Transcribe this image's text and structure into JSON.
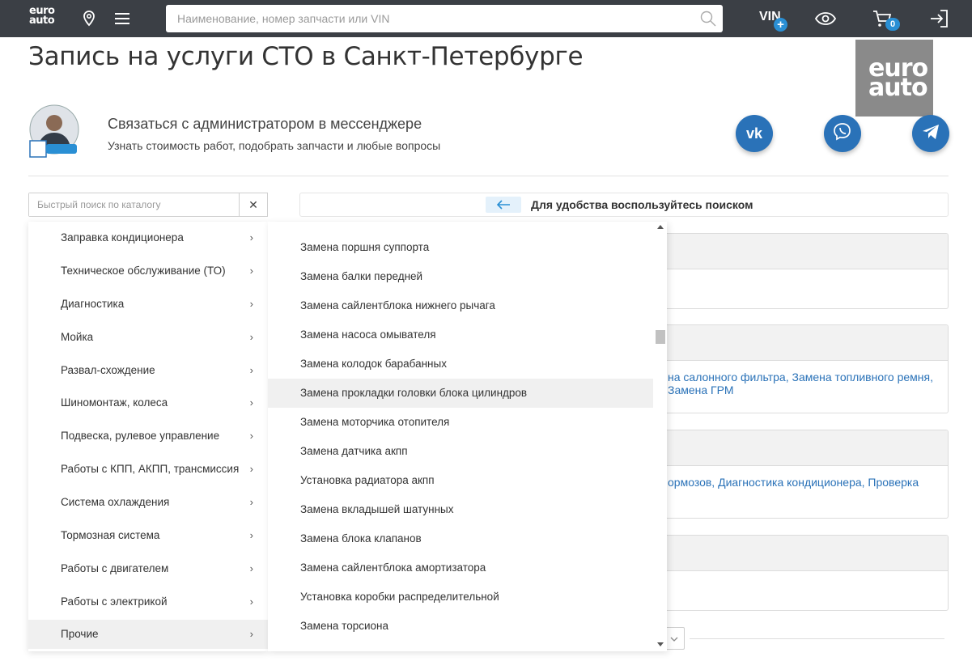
{
  "header": {
    "logo_line1": "euro",
    "logo_line2": "auto",
    "search_placeholder": "Наименование, номер запчасти или VIN",
    "vin_label": "VIN",
    "vin_plus": "+",
    "cart_count": "0"
  },
  "page": {
    "title": "Запись на услуги СТО в Санкт-Петербурге",
    "logo_line1": "euro",
    "logo_line2": "auto"
  },
  "messenger": {
    "title": "Связаться с администратором в мессенджере",
    "subtitle": "Узнать стоимость работ, подобрать запчасти и любые вопросы",
    "vk_label": "vk"
  },
  "quick_search": {
    "placeholder": "Быстрый поиск по каталогу",
    "clear": "✕"
  },
  "hint": {
    "text": "Для удобства воспользуйтесь поиском"
  },
  "cards": [
    {
      "text": ""
    },
    {
      "text": "на салонного фильтра, Замена топливного ремня, Замена ГРМ"
    },
    {
      "text": "ормозов, Диагностика кондиционера, Проверка"
    },
    {
      "text": ""
    }
  ],
  "categories": [
    {
      "label": "Заправка кондиционера"
    },
    {
      "label": "Техническое обслуживание (ТО)"
    },
    {
      "label": "Диагностика"
    },
    {
      "label": "Мойка"
    },
    {
      "label": "Развал-схождение"
    },
    {
      "label": "Шиномонтаж, колеса"
    },
    {
      "label": "Подвеска, рулевое управление"
    },
    {
      "label": "Работы с КПП, АКПП, трансмиссия"
    },
    {
      "label": "Система охлаждения"
    },
    {
      "label": "Тормозная система"
    },
    {
      "label": "Работы с двигателем"
    },
    {
      "label": "Работы с электрикой"
    },
    {
      "label": "Прочие"
    }
  ],
  "subitems": [
    {
      "label": "Замена поршня суппорта"
    },
    {
      "label": "Замена балки передней"
    },
    {
      "label": "Замена сайлентблока нижнего рычага"
    },
    {
      "label": "Замена насоса омывателя"
    },
    {
      "label": "Замена колодок барабанных"
    },
    {
      "label": "Замена прокладки головки блока цилиндров"
    },
    {
      "label": "Замена моторчика отопителя"
    },
    {
      "label": "Замена датчика акпп"
    },
    {
      "label": "Установка радиатора акпп"
    },
    {
      "label": "Замена вкладышей шатунных"
    },
    {
      "label": "Замена блока клапанов"
    },
    {
      "label": "Замена сайлентблока амортизатора"
    },
    {
      "label": "Установка коробки распределительной"
    },
    {
      "label": "Замена торсиона"
    }
  ],
  "colors": {
    "header_bg": "#3b3f45",
    "accent": "#2a72b8",
    "badge": "#2a8fd4"
  }
}
